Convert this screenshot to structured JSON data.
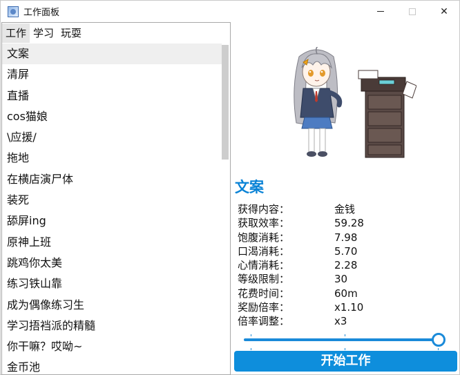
{
  "window": {
    "title": "工作面板",
    "icon": "app-window-icon",
    "controls": {
      "minimize": "minimize-icon",
      "maximize": "maximize-icon",
      "close": "✕"
    }
  },
  "menu": {
    "tabs": [
      {
        "label": "工作",
        "active": true
      },
      {
        "label": "学习",
        "active": false
      },
      {
        "label": "玩耍",
        "active": false
      }
    ]
  },
  "task_list": {
    "items": [
      "文案",
      "清屏",
      "直播",
      "cos猫娘",
      "\\应援/",
      "拖地",
      "在横店演尸体",
      "装死",
      "舔屏ing",
      "原神上班",
      "跳鸡你太美",
      "练习铁山靠",
      "成为偶像练习生",
      "学习捂裆派的精髓",
      "你干嘛？哎呦~",
      "金币池"
    ],
    "selected_index": 0
  },
  "details": {
    "job_title": "文案",
    "stats": [
      {
        "label": "获得内容：",
        "value": "金钱"
      },
      {
        "label": "获取效率：",
        "value": "59.28"
      },
      {
        "label": "饱腹消耗：",
        "value": "7.98"
      },
      {
        "label": "口渴消耗：",
        "value": "5.70"
      },
      {
        "label": "心情消耗：",
        "value": "2.28"
      },
      {
        "label": "等级限制：",
        "value": "30"
      },
      {
        "label": "花费时间：",
        "value": "60m"
      },
      {
        "label": "奖励倍率：",
        "value": "x1.10"
      },
      {
        "label": "倍率调整：",
        "value": "x3"
      }
    ],
    "multiplier_slider": {
      "level": 1.0
    },
    "start_button": "开始工作"
  },
  "colors": {
    "accent": "#0e8edc",
    "title_blue": "#0a83d6",
    "selected_bg": "#efefef"
  }
}
